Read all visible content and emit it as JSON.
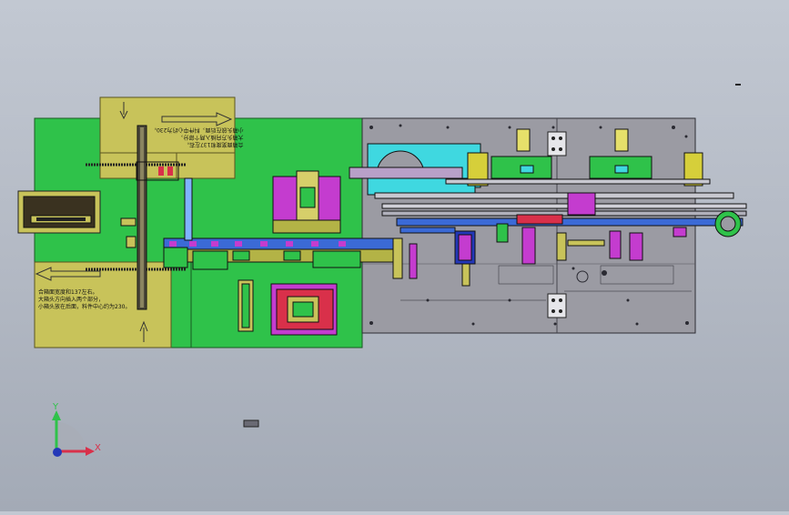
{
  "viewport": {
    "title": ""
  },
  "notes": {
    "top_left_line1": "合箱面宽度和137左右。",
    "top_left_line2": "大箱头方向插入两个部分，",
    "top_left_line3": "小箱头放在后面，料件中心约为230。",
    "bottom_left_line1": "合箱面宽度和137左右。",
    "bottom_left_line2": "大箱头方向插入两个部分，",
    "bottom_left_line3": "小箱头放在后面，料件中心约为230。"
  },
  "triad": {
    "x_label": "X",
    "y_label": "Y"
  },
  "colors": {
    "green": "#2fc24a",
    "yellow": "#c8c35a",
    "gray_plate": "#9a9aa3",
    "magenta": "#c43ccf",
    "cyan": "#3fd8e0",
    "red": "#d9304a",
    "blue": "#2438b8"
  }
}
